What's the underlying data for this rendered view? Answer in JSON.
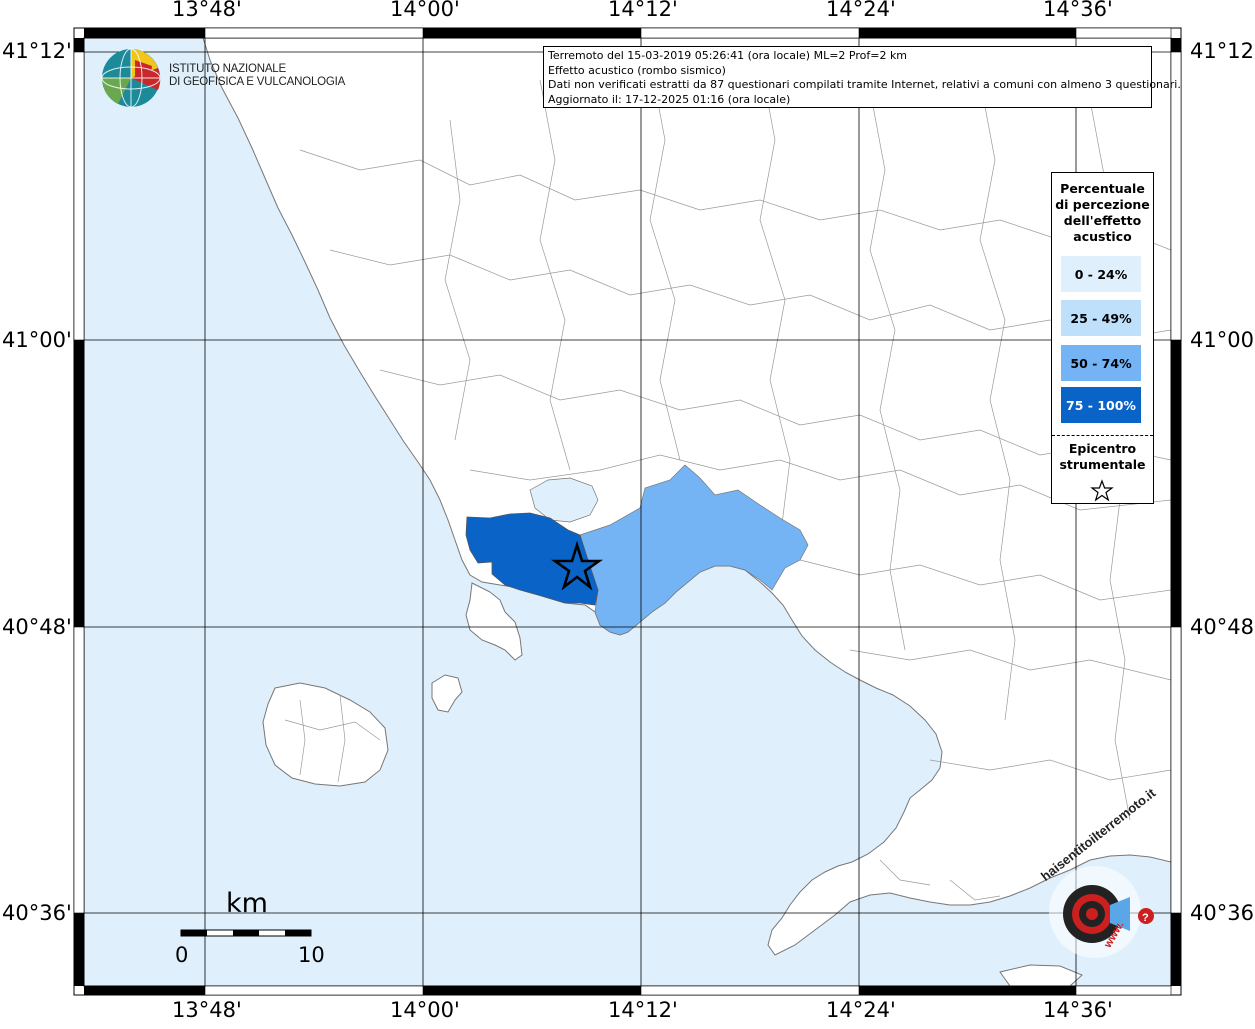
{
  "axes": {
    "top_longitudes": [
      "13°48'",
      "14°00'",
      "14°12'",
      "14°24'",
      "14°36'"
    ],
    "bottom_longitudes": [
      "13°48'",
      "14°00'",
      "14°12'",
      "14°24'",
      "14°36'"
    ],
    "left_latitudes": [
      "41°12'",
      "41°00'",
      "40°48'",
      "40°36'"
    ],
    "right_latitudes": [
      "41°12'",
      "41°00'",
      "40°48'",
      "40°36'"
    ]
  },
  "info": {
    "line1": "Terremoto del 15-03-2019 05:26:41 (ora locale) ML=2 Prof=2 km",
    "line2": "Effetto acustico (rombo sismico)",
    "line3": "Dati non verificati estratti da 87 questionari compilati tramite Internet, relativi a comuni con almeno 3 questionari.",
    "line4": "Aggiornato il: 17-12-2025 01:16 (ora locale)"
  },
  "logo": {
    "line1": "ISTITUTO NAZIONALE",
    "line2": "DI GEOFISICA E VULCANOLOGIA"
  },
  "legend": {
    "title_lines": [
      "Percentuale",
      "di percezione",
      "dell'effetto",
      "acustico"
    ],
    "items": [
      {
        "label": "0 - 24%",
        "color": "#dff0fc"
      },
      {
        "label": "25 - 49%",
        "color": "#bfe0fb"
      },
      {
        "label": "50 - 74%",
        "color": "#74b4f5"
      },
      {
        "label": "75 - 100%",
        "color": "#0a64c8"
      }
    ],
    "epicenter_lines": [
      "Epicentro",
      "strumentale"
    ]
  },
  "scale_bar": {
    "unit": "km",
    "min_label": "0",
    "max_label": "10"
  },
  "hst_logo": {
    "text": "haisentitoilterremoto.it",
    "sub": "www."
  },
  "colors": {
    "sea": "#dff0fc",
    "land": "#ffffff",
    "pct_0_24": "#dff0fc",
    "pct_25_49": "#bfe0fb",
    "pct_50_74": "#74b4f5",
    "pct_75_100": "#0a64c8"
  }
}
